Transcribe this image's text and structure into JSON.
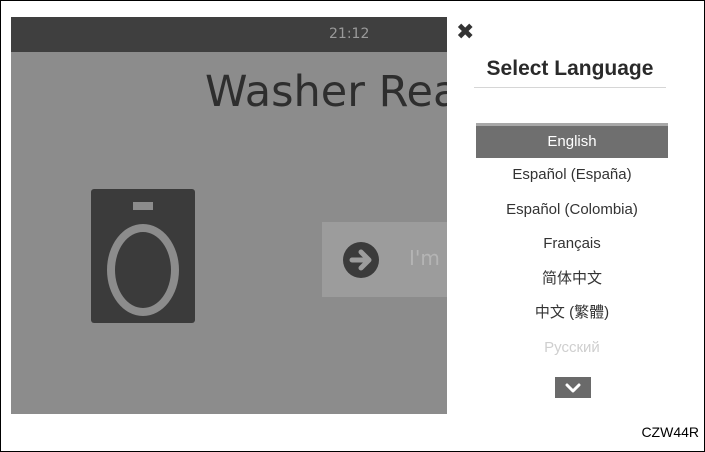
{
  "status_bar": {
    "time": "21:12"
  },
  "main": {
    "headline": "Washer Rea",
    "ready_button_label": "I'm"
  },
  "language_panel": {
    "title": "Select Language",
    "close_icon": "close-icon",
    "languages": [
      {
        "label": "English",
        "selected": true
      },
      {
        "label": "Español (España)",
        "selected": false
      },
      {
        "label": "Español (Colombia)",
        "selected": false
      },
      {
        "label": "Français",
        "selected": false
      },
      {
        "label": "简体中文",
        "selected": false
      },
      {
        "label": "中文 (繁體)",
        "selected": false
      },
      {
        "label": "Русский",
        "selected": false
      }
    ],
    "scroll_icon": "chevron-down-icon"
  },
  "figure_caption": "CZW44R",
  "colors": {
    "overlay": "#8c8c8c",
    "statusbar": "#3f3f3f",
    "selected": "#6f6f6f"
  }
}
